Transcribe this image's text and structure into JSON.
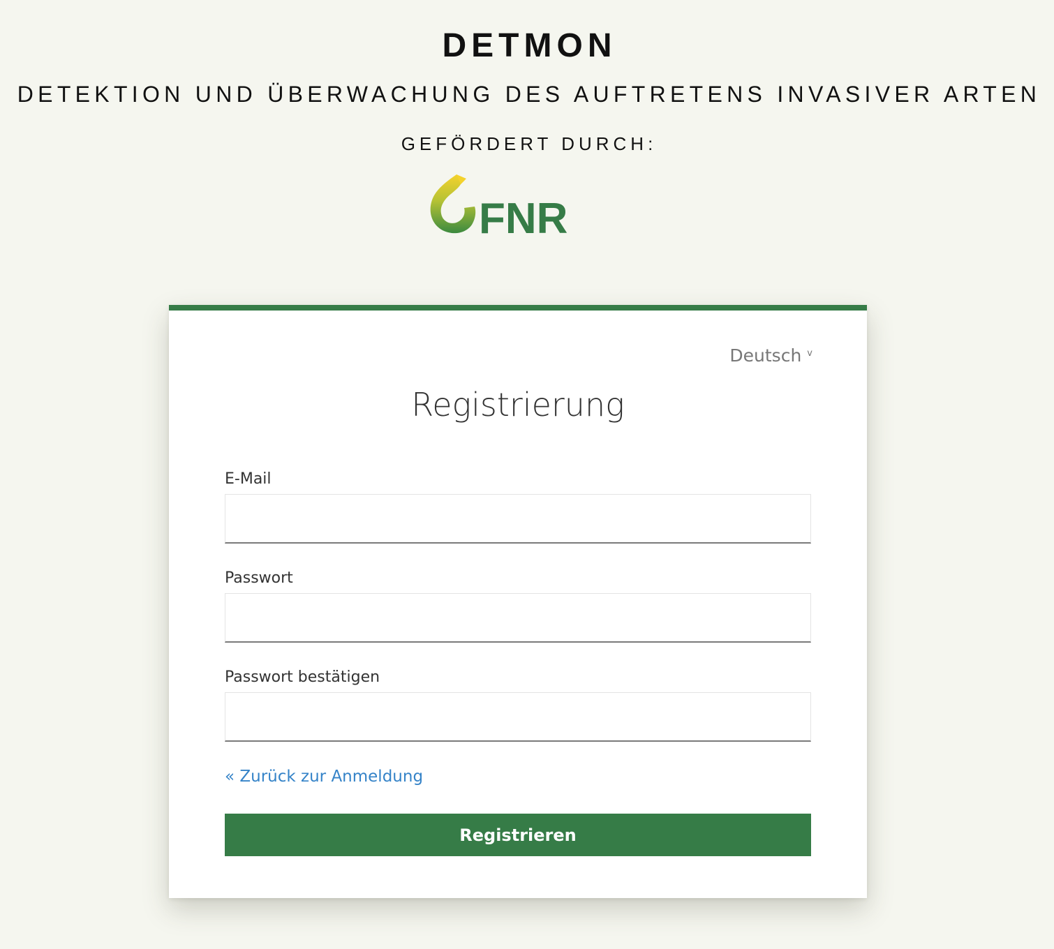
{
  "header": {
    "title": "DETMON",
    "subtitle": "DETEKTION UND ÜBERWACHUNG DES AUFTRETENS INVASIVER ARTEN",
    "funded_by": "GEFÖRDERT DURCH:",
    "logo_text": "FNR"
  },
  "colors": {
    "background": "#f5f6ef",
    "brand_green": "#367c47",
    "link_blue": "#3583c8",
    "logo_yellow": "#f2cf2a"
  },
  "card": {
    "language": "Deutsch",
    "language_chevron": "v",
    "title": "Registrierung",
    "fields": [
      {
        "label": "E-Mail",
        "value": ""
      },
      {
        "label": "Passwort",
        "value": ""
      },
      {
        "label": "Passwort bestätigen",
        "value": ""
      }
    ],
    "back_link": "« Zurück zur Anmeldung",
    "submit_label": "Registrieren"
  }
}
